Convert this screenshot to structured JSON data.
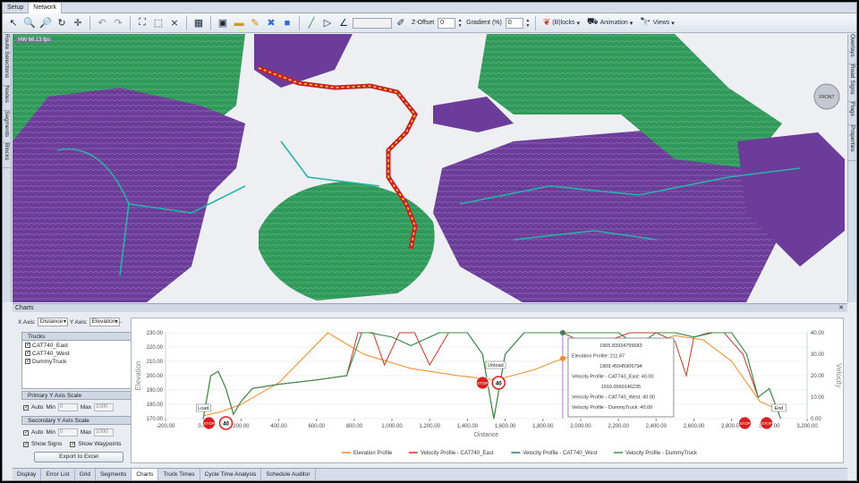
{
  "top_tabs": [
    {
      "label": "Setup"
    },
    {
      "label": "Network"
    }
  ],
  "toolbar": {
    "zoffset_label": "Z-Offset",
    "zoffset_value": "0",
    "gradient_label": "Gradient (%)",
    "gradient_value": "0",
    "blocks_label": "(B)locks",
    "animation_label": "Animation",
    "views_label": "Views"
  },
  "left_tabs": [
    "Route Selections",
    "Nodes",
    "Segments",
    "Blocks"
  ],
  "right_tabs": [
    "Overlays",
    "Road Signs",
    "Flags",
    "Properties"
  ],
  "map": {
    "fps": "HW 66.13 fps",
    "compass": "FRONT"
  },
  "charts": {
    "title": "Charts",
    "x_axis_label": "X Axis:",
    "x_axis_value": "Distance",
    "y_axis_label": "Y Axis:",
    "y_axis_value": "Elevation,...",
    "trucks_header": "Trucks",
    "trucks": [
      "CAT740_East",
      "CAT740_West",
      "DummyTruck"
    ],
    "primary_header": "Primary Y Axis Scale",
    "secondary_header": "Secondary Y Axis Scale",
    "auto_label": "Auto",
    "min_label": "Min",
    "max_label": "Max",
    "primary_min": "0",
    "primary_max": "1000",
    "secondary_min": "0",
    "secondary_max": "1000",
    "show_signs": "Show Signs",
    "show_waypoints": "Show Waypoints",
    "export_label": "Export to Excel"
  },
  "chart_data": {
    "type": "line",
    "xlabel": "Distance",
    "ylabel": "Elevation",
    "y2label": "Velocity",
    "xlim": [
      -200,
      3200
    ],
    "ylim": [
      170,
      230
    ],
    "y2lim": [
      0,
      40
    ],
    "x_ticks": [
      "-200.00",
      "0.00",
      "200.00",
      "400.00",
      "600.00",
      "800.00",
      "1,000.00",
      "1,200.00",
      "1,400.00",
      "1,600.00",
      "1,800.00",
      "2,000.00",
      "2,200.00",
      "2,400.00",
      "2,600.00",
      "2,800.00",
      "3,000.00",
      "3,200.00"
    ],
    "y_ticks": [
      "170.00",
      "180.00",
      "190.00",
      "200.00",
      "210.00",
      "220.00",
      "230.00"
    ],
    "y2_ticks": [
      "0.00",
      "10.00",
      "20.00",
      "30.00",
      "40.00"
    ],
    "series": [
      {
        "name": "Elevation Profile",
        "axis": "y",
        "color": "#f08a24",
        "x": [
          0,
          100,
          200,
          400,
          660,
          850,
          1100,
          1350,
          1550,
          1750,
          1905,
          2100,
          2300,
          2500,
          2650,
          2800,
          2950,
          3050
        ],
        "y": [
          172,
          175,
          180,
          195,
          230,
          215,
          205,
          200,
          197,
          204,
          212,
          217,
          220,
          228,
          225,
          210,
          182,
          176
        ]
      },
      {
        "name": "Velocity Profile - CAT740_East",
        "axis": "y2",
        "color": "#c0392b",
        "x": [
          0,
          40,
          80,
          120,
          160,
          200,
          260,
          400,
          600,
          760,
          820,
          900,
          960,
          1040,
          1120,
          1200,
          1300,
          1400,
          1480,
          1540,
          1600,
          1700,
          1760,
          1905,
          2000,
          2060,
          2120,
          2200,
          2260,
          2400,
          2500,
          2560,
          2600,
          2680,
          2760,
          2860,
          2940,
          3000,
          3060
        ],
        "y": [
          0,
          20,
          22,
          14,
          2,
          8,
          14,
          16,
          18,
          20,
          40,
          40,
          25,
          40,
          40,
          25,
          40,
          40,
          30,
          0,
          30,
          40,
          40,
          40,
          36,
          24,
          36,
          38,
          40,
          40,
          36,
          20,
          38,
          40,
          40,
          30,
          10,
          14,
          0
        ]
      },
      {
        "name": "Velocity Profile - CAT740_West",
        "axis": "y2",
        "color": "#2e6d86",
        "x": [
          0,
          40,
          80,
          120,
          160,
          200,
          260,
          400,
          600,
          760,
          800,
          840,
          880,
          1000,
          1100,
          1250,
          1300,
          1400,
          1480,
          1540,
          1600,
          1700,
          1760,
          1905,
          2000,
          2100,
          2200,
          2300,
          2400,
          2500,
          2600,
          2700,
          2800,
          2880,
          2940,
          3000,
          3060
        ],
        "y": [
          0,
          20,
          22,
          14,
          2,
          8,
          14,
          16,
          18,
          20,
          30,
          40,
          40,
          38,
          34,
          40,
          40,
          40,
          30,
          0,
          30,
          40,
          40,
          40,
          40,
          40,
          40,
          34,
          40,
          40,
          38,
          40,
          40,
          30,
          10,
          14,
          0
        ]
      },
      {
        "name": "Velocity Profile - DummyTruck",
        "axis": "y2",
        "color": "#3f8f3f",
        "x": [
          0,
          40,
          80,
          120,
          160,
          200,
          260,
          400,
          600,
          760,
          800,
          840,
          880,
          1000,
          1100,
          1250,
          1300,
          1400,
          1480,
          1540,
          1600,
          1700,
          1760,
          1905,
          2000,
          2100,
          2200,
          2300,
          2400,
          2500,
          2600,
          2700,
          2800,
          2880,
          2940,
          3000,
          3060
        ],
        "y": [
          0,
          20,
          22,
          14,
          2,
          8,
          14,
          16,
          18,
          20,
          30,
          40,
          40,
          38,
          34,
          40,
          40,
          40,
          30,
          0,
          30,
          40,
          40,
          40,
          40,
          40,
          40,
          34,
          40,
          40,
          38,
          40,
          40,
          30,
          10,
          14,
          0
        ]
      }
    ],
    "annotations": [
      {
        "text": "Load",
        "x": 10
      },
      {
        "text": "Unload",
        "x": 1545
      },
      {
        "text": "End",
        "x": 3060
      }
    ],
    "signs": [
      {
        "kind": "stop",
        "x": 30,
        "text": "STOP"
      },
      {
        "kind": "limit",
        "x": 120,
        "text": "40"
      },
      {
        "kind": "stop",
        "x": 1480,
        "text": "STOP"
      },
      {
        "kind": "limit",
        "x": 1565,
        "text": "40"
      },
      {
        "kind": "stop",
        "x": 2870,
        "text": "STOP"
      },
      {
        "kind": "stop",
        "x": 2985,
        "text": "STOP"
      }
    ],
    "tooltip": {
      "x": 1905,
      "lines": [
        "1905.83934795683",
        "Elevation Profile: 211.87",
        "1909.45045906794",
        "Velocity Profile - CAT740_East: 40.00",
        "1910.0060146235",
        "Velocity Profile - CAT740_West: 40.00",
        "Velocity Profile - DummyTruck: 40.00"
      ]
    },
    "legend_position": "bottom"
  },
  "bottom_tabs": [
    {
      "label": "Display"
    },
    {
      "label": "Error List"
    },
    {
      "label": "Grid"
    },
    {
      "label": "Segments"
    },
    {
      "label": "Charts"
    },
    {
      "label": "Truck Times"
    },
    {
      "label": "Cycle Time Analysis"
    },
    {
      "label": "Schedule Auditor"
    }
  ],
  "colors": {
    "pit_green": "#2f9a5a",
    "pit_purple": "#6b3c9a",
    "haul_route": "#c8202a",
    "route_yellow": "#f2d21c"
  }
}
